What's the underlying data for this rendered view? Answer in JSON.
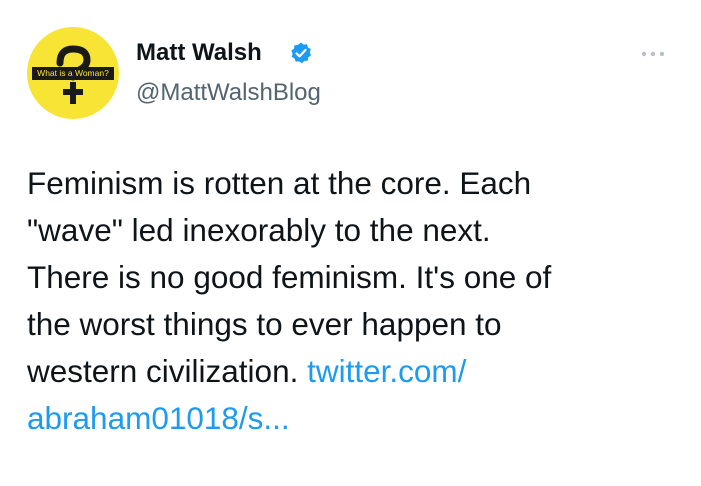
{
  "user": {
    "display_name": "Matt Walsh",
    "handle": "@MattWalshBlog",
    "verified": true,
    "avatar_text": "What is a Woman?",
    "avatar_icon": "question-mark-with-cross",
    "avatar_color": "#f7e434"
  },
  "tweet": {
    "text": "Feminism is rotten at the core. Each\n\"wave\" led inexorably to the next.\nThere is no good feminism. It's one of\nthe worst things to ever happen to\nwestern civilization. ",
    "link_text": "twitter.com/\nabraham01018/s..."
  },
  "menu_icon": "more-dots-icon",
  "colors": {
    "text": "#0f1419",
    "handle": "#536471",
    "link": "#1d9bf0",
    "verified": "#1d9bf0"
  }
}
